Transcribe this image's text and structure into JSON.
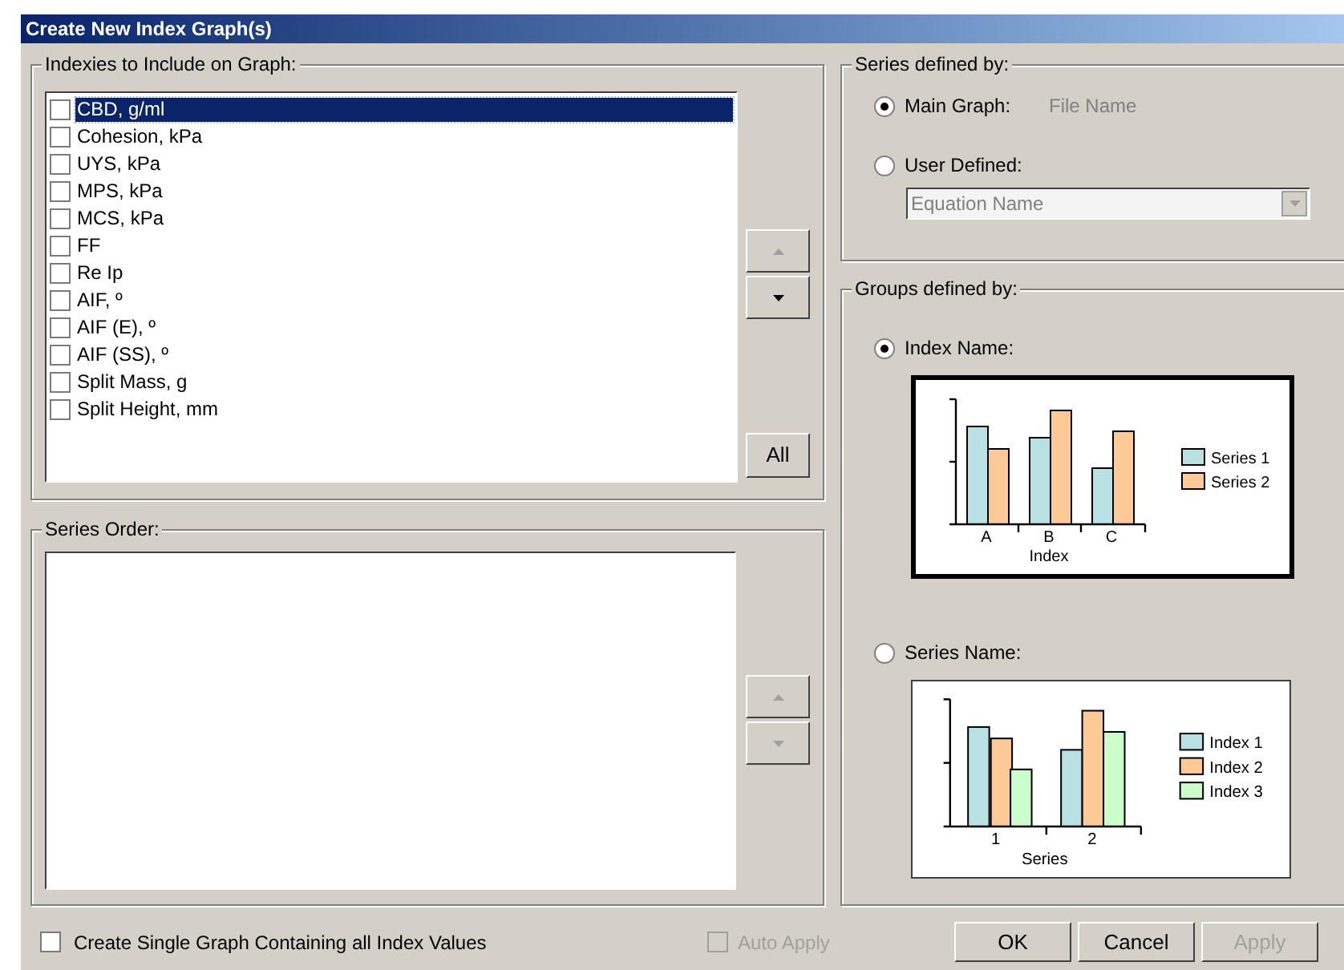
{
  "window": {
    "title": "Create New Index Graph(s)"
  },
  "indexes_group": {
    "label": "Indexies to Include on Graph:",
    "items": [
      {
        "label": "CBD, g/ml",
        "checked": false,
        "selected": true
      },
      {
        "label": "Cohesion, kPa",
        "checked": false,
        "selected": false
      },
      {
        "label": "UYS, kPa",
        "checked": false,
        "selected": false
      },
      {
        "label": "MPS, kPa",
        "checked": false,
        "selected": false
      },
      {
        "label": "MCS, kPa",
        "checked": false,
        "selected": false
      },
      {
        "label": "FF",
        "checked": false,
        "selected": false
      },
      {
        "label": "Re Ip",
        "checked": false,
        "selected": false
      },
      {
        "label": "AIF, º",
        "checked": false,
        "selected": false
      },
      {
        "label": "AIF (E), º",
        "checked": false,
        "selected": false
      },
      {
        "label": "AIF (SS), º",
        "checked": false,
        "selected": false
      },
      {
        "label": "Split Mass, g",
        "checked": false,
        "selected": false
      },
      {
        "label": "Split Height, mm",
        "checked": false,
        "selected": false
      }
    ],
    "move_buttons": [
      {
        "kind": "up",
        "disabled": true
      },
      {
        "kind": "down",
        "disabled": false
      }
    ],
    "all_button": "All"
  },
  "series_order": {
    "label": "Series Order:",
    "move_buttons": [
      {
        "kind": "up",
        "disabled": true
      },
      {
        "kind": "down",
        "disabled": true
      }
    ]
  },
  "series_defined": {
    "label": "Series defined by:",
    "options": [
      {
        "label": "Main Graph:",
        "selected": true,
        "value": "File Name"
      },
      {
        "label": "User Defined:",
        "selected": false
      }
    ],
    "equation_select": {
      "placeholder": "Equation Name",
      "disabled": true
    }
  },
  "groups_defined": {
    "label": "Groups defined by:",
    "options": [
      {
        "label": "Index Name:",
        "selected": true,
        "preview": {
          "categories": [
            "A",
            "B",
            "C"
          ],
          "xlabel": "Index",
          "legend": [
            {
              "name": "Series 1",
              "color": "#b9e0e3"
            },
            {
              "name": "Series 2",
              "color": "#fdc997"
            }
          ]
        }
      },
      {
        "label": "Series Name:",
        "selected": false,
        "preview": {
          "categories": [
            "1",
            "2"
          ],
          "xlabel": "Series",
          "legend": [
            {
              "name": "Index 1",
              "color": "#b9e0e3"
            },
            {
              "name": "Index 2",
              "color": "#fdc997"
            },
            {
              "name": "Index 3",
              "color": "#ccfdcc"
            }
          ]
        }
      }
    ]
  },
  "bottom": {
    "single_graph": {
      "label": "Create Single Graph Containing all Index Values",
      "checked": false
    },
    "auto_apply": {
      "label": "Auto Apply",
      "checked": false,
      "disabled": true
    },
    "buttons": [
      {
        "label": "OK",
        "disabled": false
      },
      {
        "label": "Cancel",
        "disabled": false
      },
      {
        "label": "Apply",
        "disabled": true
      }
    ]
  }
}
